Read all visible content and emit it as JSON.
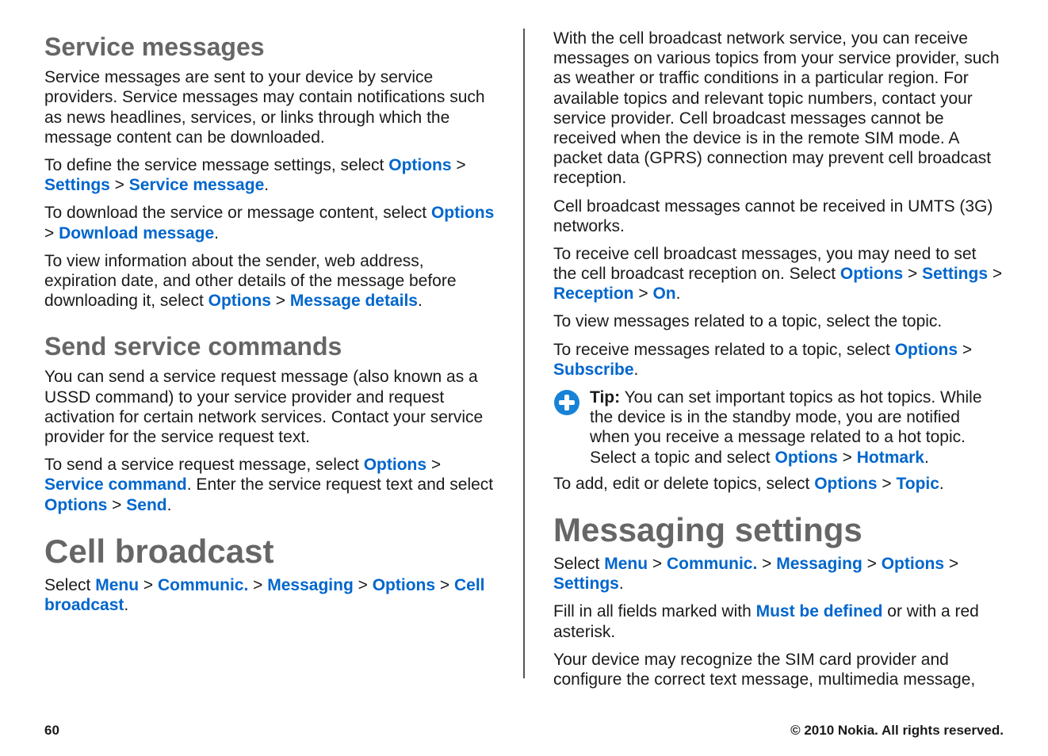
{
  "footer": {
    "page": "60",
    "copyright": "© 2010 Nokia. All rights reserved."
  },
  "left": {
    "h_service_messages": "Service messages",
    "p_sm_intro": "Service messages are sent to your device by service providers. Service messages may contain notifications such as news headlines, services, or links through which the message content can be downloaded.",
    "p_sm_define_a": "To define the service message settings, select ",
    "p_sm_define_opts": "Options",
    "p_sm_define_gt1": " > ",
    "p_sm_define_settings": "Settings",
    "p_sm_define_gt2": " > ",
    "p_sm_define_service_message": "Service message",
    "p_sm_define_end": ".",
    "p_sm_download_a": "To download the service or message content, select ",
    "p_sm_download_opts": "Options",
    "p_sm_download_gt": " > ",
    "p_sm_download_dl": "Download message",
    "p_sm_download_end": ".",
    "p_sm_view_a": "To view information about the sender, web address, expiration date, and other details of the message before downloading it, select ",
    "p_sm_view_opts": "Options",
    "p_sm_view_gt": " > ",
    "p_sm_view_details": "Message details",
    "p_sm_view_end": ".",
    "h_send_service_commands": "Send service commands",
    "p_ssc_intro": "You can send a service request message (also known as a USSD command) to your service provider and request activation for certain network services. Contact your service provider for the service request text.",
    "p_ssc_send_a": "To send a service request message, select ",
    "p_ssc_send_opts1": "Options",
    "p_ssc_send_gt1": " > ",
    "p_ssc_send_servicecmd": "Service command",
    "p_ssc_send_mid": ". Enter the service request text and select ",
    "p_ssc_send_opts2": "Options",
    "p_ssc_send_gt2": " > ",
    "p_ssc_send_send": "Send",
    "p_ssc_send_end": ".",
    "h_cell_broadcast": "Cell broadcast",
    "p_cb_select_a": "Select ",
    "p_cb_menu": "Menu",
    "p_cb_gt1": " > ",
    "p_cb_communic": "Communic.",
    "p_cb_gt2": " > ",
    "p_cb_messaging": "Messaging",
    "p_cb_gt3": " > ",
    "p_cb_options": "Options",
    "p_cb_gt4": " > ",
    "p_cb_cellbroadcast": "Cell broadcast",
    "p_cb_end": "."
  },
  "right": {
    "p_cb_intro": "With the cell broadcast network service, you can receive messages on various topics from your service provider, such as weather or traffic conditions in a particular region. For available topics and relevant topic numbers, contact your service provider. Cell broadcast messages cannot be received when the device is in the remote SIM mode. A packet data (GPRS) connection may prevent cell broadcast reception.",
    "p_cb_umts": "Cell broadcast messages cannot be received in UMTS (3G) networks.",
    "p_cb_recv_a": "To receive cell broadcast messages, you may need to set the cell broadcast reception on. Select ",
    "p_cb_recv_opts": "Options",
    "p_cb_recv_gt1": " > ",
    "p_cb_recv_settings": "Settings",
    "p_cb_recv_gt2": " > ",
    "p_cb_recv_reception": "Reception",
    "p_cb_recv_gt3": " > ",
    "p_cb_recv_on": "On",
    "p_cb_recv_end": ".",
    "p_cb_view_topic": "To view messages related to a topic, select the topic.",
    "p_cb_subscribe_a": "To receive messages related to a topic, select ",
    "p_cb_subscribe_opts": "Options",
    "p_cb_subscribe_gt": " > ",
    "p_cb_subscribe_sub": "Subscribe",
    "p_cb_subscribe_end": ".",
    "tip_label": "Tip:",
    "tip_text_a": " You can set important topics as hot topics. While the device is in the standby mode, you are notified when you receive a message related to a hot topic. Select a topic and select ",
    "tip_opts": "Options",
    "tip_gt": " > ",
    "tip_hotmark": "Hotmark",
    "tip_end": ".",
    "p_cb_topic_a": "To add, edit or delete topics, select ",
    "p_cb_topic_opts": "Options",
    "p_cb_topic_gt": " > ",
    "p_cb_topic_topic": "Topic",
    "p_cb_topic_end": ".",
    "h_messaging_settings": "Messaging settings",
    "p_ms_select_a": "Select ",
    "p_ms_menu": "Menu",
    "p_ms_gt1": " > ",
    "p_ms_communic": "Communic.",
    "p_ms_gt2": " > ",
    "p_ms_messaging": "Messaging",
    "p_ms_gt3": " > ",
    "p_ms_options": "Options",
    "p_ms_gt4": " > ",
    "p_ms_settings": "Settings",
    "p_ms_end": ".",
    "p_ms_fill_a": "Fill in all fields marked with ",
    "p_ms_mustbe": "Must be defined",
    "p_ms_fill_b": " or with a red asterisk.",
    "p_ms_sim": "Your device may recognize the SIM card provider and configure the correct text message, multimedia message,"
  }
}
